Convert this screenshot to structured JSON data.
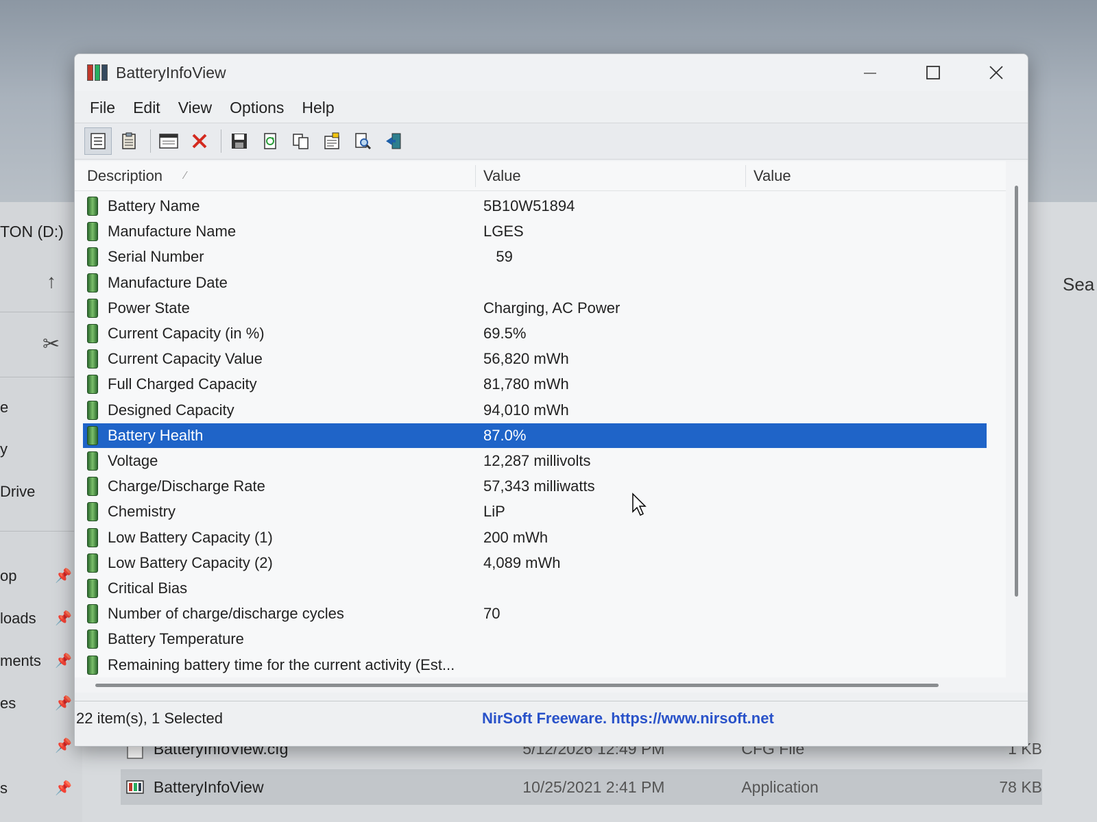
{
  "explorer": {
    "drive_label": "TON (D:)",
    "search_partial": "Sea",
    "nav_items": [
      "e",
      "y",
      "Drive",
      "op",
      "loads",
      "ments",
      "es",
      "",
      "s"
    ],
    "files": [
      {
        "name": "BatteryInfoView.cfg",
        "date": "5/12/2026 12:49 PM",
        "type": "CFG File",
        "size": "1 KB"
      },
      {
        "name": "BatteryInfoView",
        "date": "10/25/2021 2:41 PM",
        "type": "Application",
        "size": "78 KB"
      }
    ]
  },
  "window": {
    "title": "BatteryInfoView",
    "menu": [
      "File",
      "Edit",
      "View",
      "Options",
      "Help"
    ],
    "toolbar_icons": [
      "list-view-icon",
      "clipboard-icon",
      "window-icon",
      "delete-icon",
      "save-icon",
      "refresh-icon",
      "copy-icon",
      "properties-icon",
      "find-icon",
      "exit-icon"
    ],
    "columns": [
      "Description",
      "Value",
      "Value"
    ],
    "rows": [
      {
        "desc": "Battery Name",
        "value": "5B10W51894",
        "value2": ""
      },
      {
        "desc": "Manufacture Name",
        "value": "LGES",
        "value2": ""
      },
      {
        "desc": "Serial Number",
        "value": "   59",
        "value2": ""
      },
      {
        "desc": "Manufacture Date",
        "value": "",
        "value2": ""
      },
      {
        "desc": "Power State",
        "value": "Charging, AC Power",
        "value2": ""
      },
      {
        "desc": "Current Capacity (in %)",
        "value": "69.5%",
        "value2": ""
      },
      {
        "desc": "Current Capacity Value",
        "value": "56,820 mWh",
        "value2": ""
      },
      {
        "desc": "Full Charged Capacity",
        "value": "81,780 mWh",
        "value2": ""
      },
      {
        "desc": "Designed Capacity",
        "value": "94,010 mWh",
        "value2": ""
      },
      {
        "desc": "Battery Health",
        "value": "87.0%",
        "value2": ""
      },
      {
        "desc": "Voltage",
        "value": "12,287 millivolts",
        "value2": ""
      },
      {
        "desc": "Charge/Discharge Rate",
        "value": "57,343 milliwatts",
        "value2": ""
      },
      {
        "desc": "Chemistry",
        "value": "LiP",
        "value2": ""
      },
      {
        "desc": "Low Battery Capacity (1)",
        "value": "200 mWh",
        "value2": ""
      },
      {
        "desc": "Low Battery Capacity (2)",
        "value": "4,089 mWh",
        "value2": ""
      },
      {
        "desc": "Critical Bias",
        "value": "",
        "value2": ""
      },
      {
        "desc": "Number of charge/discharge cycles",
        "value": "70",
        "value2": ""
      },
      {
        "desc": "Battery Temperature",
        "value": "",
        "value2": ""
      },
      {
        "desc": "Remaining battery time for the current activity (Est...",
        "value": "",
        "value2": ""
      }
    ],
    "selected_row": 9,
    "status_text": "22 item(s), 1 Selected",
    "status_link": "NirSoft Freeware. https://www.nirsoft.net"
  },
  "colors": {
    "selection": "#1f64c8",
    "link": "#2952c9"
  }
}
